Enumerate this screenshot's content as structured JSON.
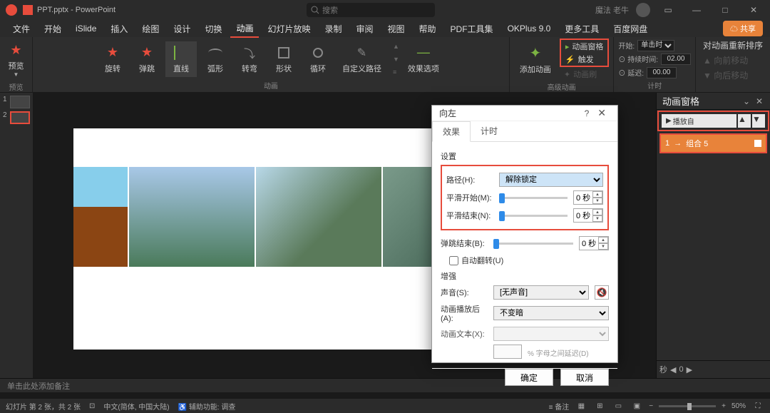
{
  "titlebar": {
    "filename": "PPT.pptx - PowerPoint",
    "search_placeholder": "搜索",
    "username": "魔法 老牛"
  },
  "menubar": {
    "items": [
      "文件",
      "开始",
      "iSlide",
      "插入",
      "绘图",
      "设计",
      "切换",
      "动画",
      "幻灯片放映",
      "录制",
      "审阅",
      "视图",
      "帮助",
      "PDF工具集",
      "OKPlus 9.0",
      "更多工具",
      "百度网盘"
    ],
    "active_index": 7,
    "share": "共享"
  },
  "ribbon": {
    "preview": {
      "label": "预览",
      "group": "预览"
    },
    "anim_items": [
      "旋转",
      "弹跳",
      "直线",
      "弧形",
      "转弯",
      "形状",
      "循环",
      "自定义路径"
    ],
    "anim_active_index": 2,
    "anim_group": "动画",
    "effect_options": "效果选项",
    "add_anim": "添加动画",
    "advanced_group": "高级动画",
    "panel": "动画窗格",
    "trigger": "触发",
    "painter": "动画刷",
    "timing": {
      "start_label": "开始:",
      "start_value": "单击时",
      "duration_label": "持续时间:",
      "duration_value": "02.00",
      "delay_label": "延迟:",
      "delay_value": "00.00",
      "group": "计时"
    },
    "reorder": {
      "title": "对动画重新排序",
      "fwd": "向前移动",
      "back": "向后移动"
    }
  },
  "thumbs": {
    "items": [
      "1",
      "2"
    ],
    "active": 1
  },
  "notes_placeholder": "单击此处添加备注",
  "anim_panel": {
    "title": "动画窗格",
    "play": "播放自",
    "item_index": "1",
    "item_name": "组合 5",
    "seconds": "秒"
  },
  "dialog": {
    "title": "向左",
    "tabs": [
      "效果",
      "计时"
    ],
    "active_tab": 0,
    "section_settings": "设置",
    "path_label": "路径(H):",
    "path_value": "解除锁定",
    "smooth_start_label": "平滑开始(M):",
    "smooth_start_value": "0 秒",
    "smooth_end_label": "平滑结束(N):",
    "smooth_end_value": "0 秒",
    "bounce_label": "弹跳结束(B):",
    "bounce_value": "0 秒",
    "autoflip": "自动翻转(U)",
    "section_enhance": "增强",
    "sound_label": "声音(S):",
    "sound_value": "[无声音]",
    "after_label": "动画播放后(A):",
    "after_value": "不变暗",
    "text_label": "动画文本(X):",
    "text_extra": "% 字母之间延迟(D)",
    "ok": "确定",
    "cancel": "取消"
  },
  "statusbar": {
    "slide_info": "幻灯片 第 2 张，共 2 张",
    "language": "中文(简体, 中国大陆)",
    "accessibility": "辅助功能: 调查",
    "notes": "备注",
    "zoom": "50%"
  }
}
